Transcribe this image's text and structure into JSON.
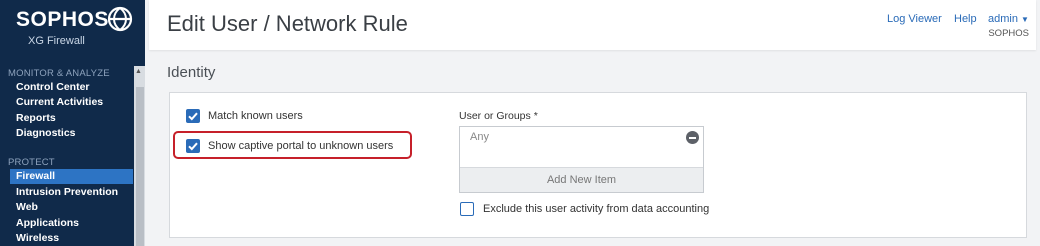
{
  "brand": {
    "name": "SOPHOS",
    "product": "XG Firewall"
  },
  "sidebar": {
    "sections": [
      {
        "title": "MONITOR & ANALYZE",
        "items": [
          "Control Center",
          "Current Activities",
          "Reports",
          "Diagnostics"
        ]
      },
      {
        "title": "PROTECT",
        "items": [
          "Firewall",
          "Intrusion Prevention",
          "Web",
          "Applications",
          "Wireless"
        ]
      }
    ],
    "active_item": "Firewall"
  },
  "header": {
    "title": "Edit User / Network Rule",
    "links": {
      "log_viewer": "Log Viewer",
      "help": "Help",
      "admin": "admin"
    },
    "admin_org": "SOPHOS"
  },
  "identity": {
    "section_title": "Identity",
    "match_known_users": {
      "label": "Match known users",
      "checked": true
    },
    "show_captive_portal": {
      "label": "Show captive portal to unknown users",
      "checked": true
    },
    "user_or_groups": {
      "label": "User or Groups *",
      "value": "Any",
      "add_label": "Add New Item"
    },
    "exclude_accounting": {
      "label": "Exclude this user activity from data accounting",
      "checked": false
    }
  },
  "colors": {
    "sidebar_bg": "#102a4a",
    "accent": "#2a6bb8",
    "highlight": "#c6202a"
  },
  "icons": [
    "sophos-logo-icon",
    "chevron-down-icon",
    "checkmark-icon",
    "remove-icon",
    "scroll-up-icon"
  ]
}
